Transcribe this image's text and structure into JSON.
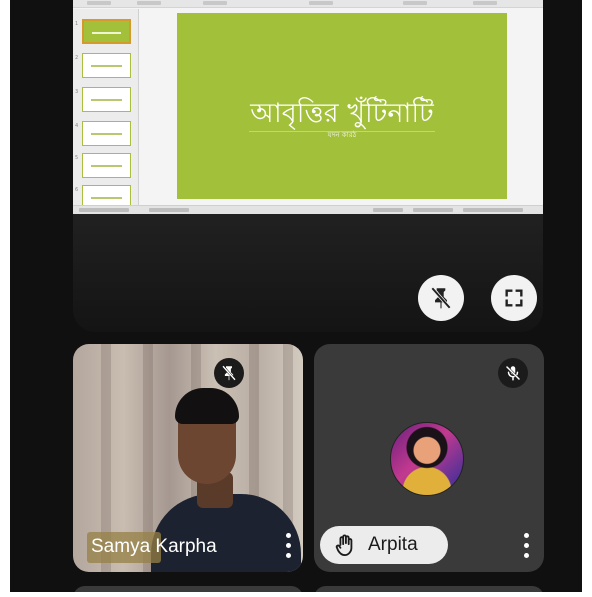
{
  "presentation": {
    "slide_title": "আবৃত্তির খুঁটিনাটি",
    "slide_subtitle": "যদন কারঠ",
    "thumbnails": [
      {
        "num": "1",
        "active": true
      },
      {
        "num": "2",
        "active": false
      },
      {
        "num": "3",
        "active": false
      },
      {
        "num": "4",
        "active": false
      },
      {
        "num": "5",
        "active": false
      },
      {
        "num": "6",
        "active": false
      }
    ],
    "controls": {
      "unpin_icon": "pin-off-icon",
      "fullscreen_icon": "fullscreen-icon"
    }
  },
  "participants": [
    {
      "name_highlight": "Samya",
      "name_rest": " Karpha",
      "mic_icon": "pin-off-icon",
      "menu_icon": "more-vert-icon"
    },
    {
      "name": "Arpita",
      "status_icon": "hand-raised-icon",
      "mic_icon": "mic-off-icon",
      "menu_icon": "more-vert-icon"
    }
  ],
  "colors": {
    "slide_green": "#a3c03a",
    "background": "#101010",
    "tile_dark": "#3a3a3a",
    "pill": "#ececec"
  }
}
